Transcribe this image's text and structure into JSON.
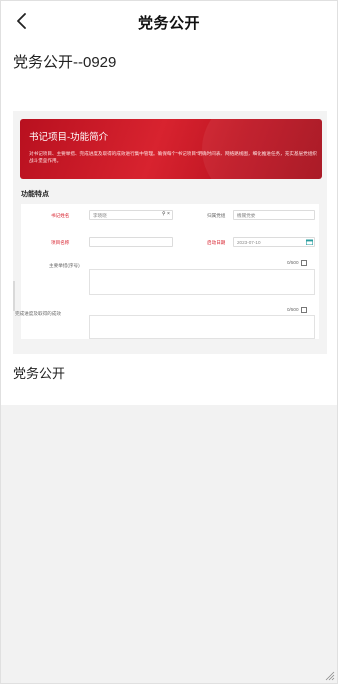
{
  "header": {
    "title": "党务公开",
    "back_icon": "chevron-left-icon"
  },
  "article": {
    "title": "党务公开--0929"
  },
  "embedded_screenshot": {
    "banner": {
      "title": "书记项目-功能简介",
      "description": "对书记项目、主要举措、完成进度及取得的成效进行集中管理。确保每个“书记项目”明确时间表、网络路线图，细化推进任务，充实基层党组织战斗堡垒作用。",
      "color": "#c8161d"
    },
    "features_label": "功能特点",
    "form": {
      "secretary_name_label": "书记姓名",
      "secretary_name_value": "李晓晓",
      "search_icon": "search-icon",
      "clear_icon": "close-icon",
      "org_label": "归属党组",
      "org_value": "機關党委",
      "project_name_label": "项目名称",
      "project_name_value": "",
      "date_label": "启动日期",
      "date_value": "2023-07-10",
      "calendar_icon": "calendar-icon",
      "measures_label": "主要举措(序号)",
      "measures_counter": "0/500",
      "progress_label": "完成进度及取得的成效",
      "progress_counter": "0/500"
    }
  },
  "section": {
    "title": "党务公开"
  },
  "colors": {
    "accent_red": "#d8232f",
    "background": "#f2f2f2"
  }
}
